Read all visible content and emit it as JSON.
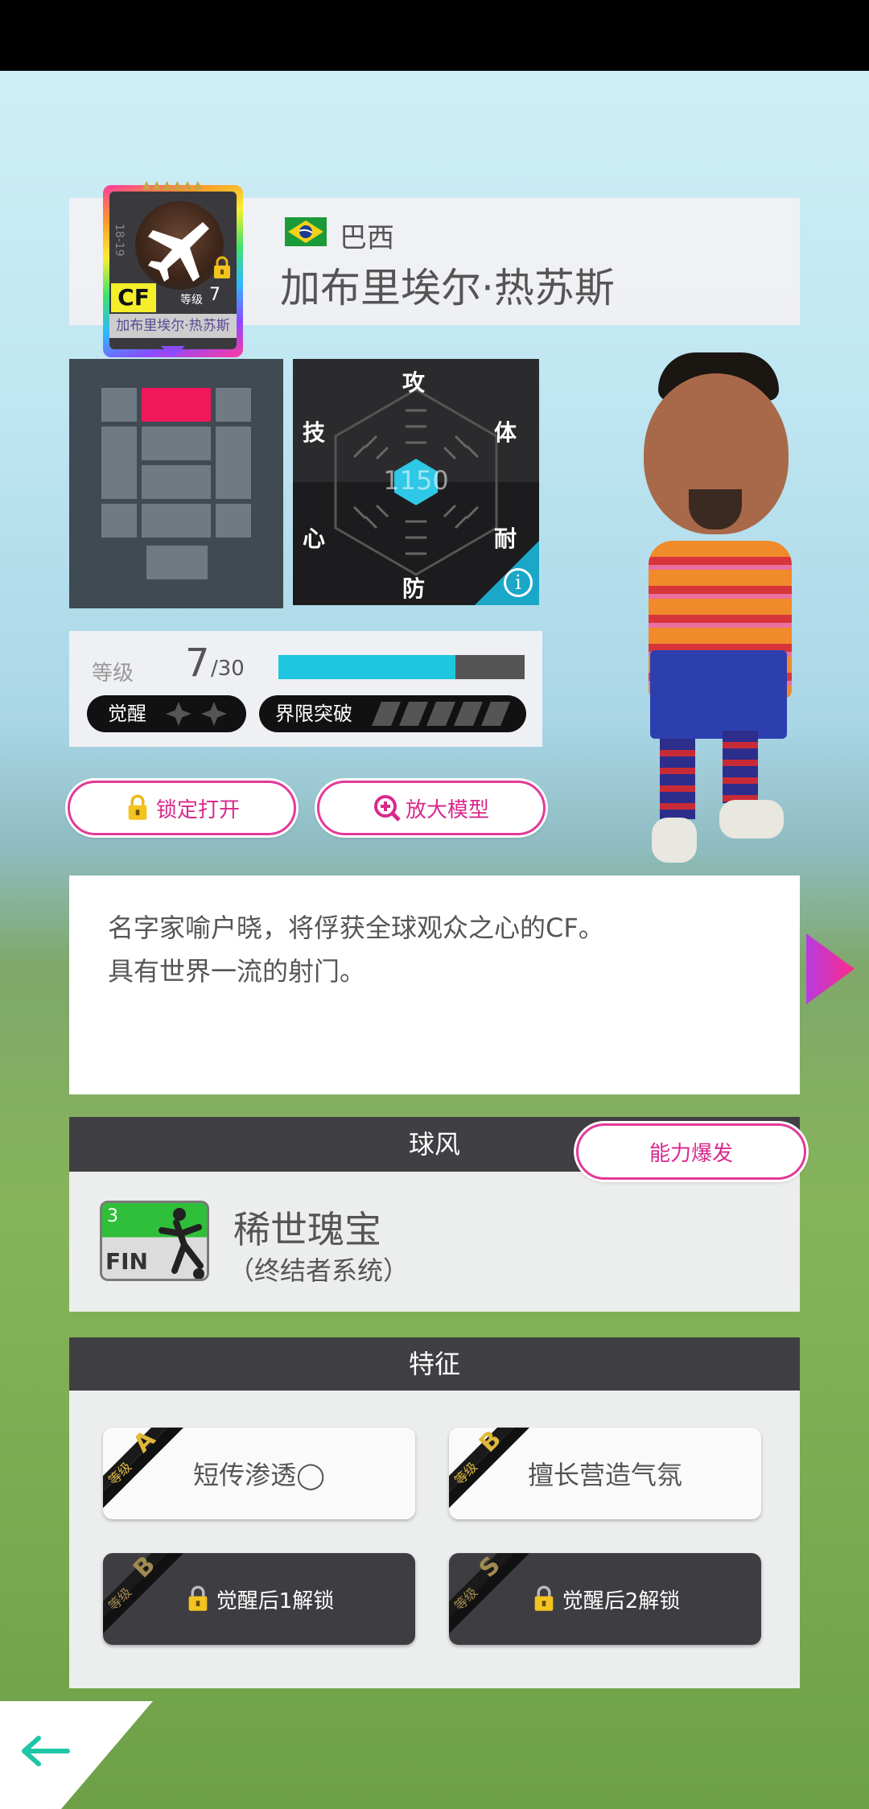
{
  "player": {
    "country": "巴西",
    "name": "加布里埃尔·热苏斯",
    "card_position": "CF",
    "card_level_label": "等级",
    "card_level": "7",
    "card_name": "加布里埃尔·热苏斯",
    "card_season": "18-19"
  },
  "radar": {
    "labels": {
      "top": "攻",
      "top_right": "体",
      "bottom_right": "耐",
      "bottom": "防",
      "bottom_left": "心",
      "top_left": "技"
    },
    "total": "1150",
    "info_icon": "info-icon"
  },
  "level": {
    "label": "等级",
    "current": "7",
    "max": "/30",
    "progress": 0.72,
    "awaken_label": "觉醒",
    "limit_break_label": "界限突破"
  },
  "buttons": {
    "lock": "锁定打开",
    "zoom": "放大模型",
    "ability_burst": "能力爆发"
  },
  "description": {
    "line1": "名字家喻户晓，将俘获全球观众之心的CF。",
    "line2": "具有世界一流的射门。"
  },
  "play_style": {
    "header": "球风",
    "badge_level": "3",
    "badge_code": "FIN",
    "name": "稀世瑰宝",
    "subtitle": "（终结者系统）"
  },
  "traits": {
    "header": "特征",
    "items": [
      {
        "grade_label": "等级",
        "grade": "A",
        "text": "短传渗透◯"
      },
      {
        "grade_label": "等级",
        "grade": "B",
        "text": "擅长营造气氛"
      },
      {
        "grade_label": "等级",
        "grade": "B",
        "text": "觉醒后1解锁"
      },
      {
        "grade_label": "等级",
        "grade": "S",
        "text": "觉醒后2解锁"
      }
    ]
  },
  "colors": {
    "accent_pink": "#e23a9a",
    "progress_cyan": "#1ec6e0",
    "position_red": "#f0185a"
  }
}
